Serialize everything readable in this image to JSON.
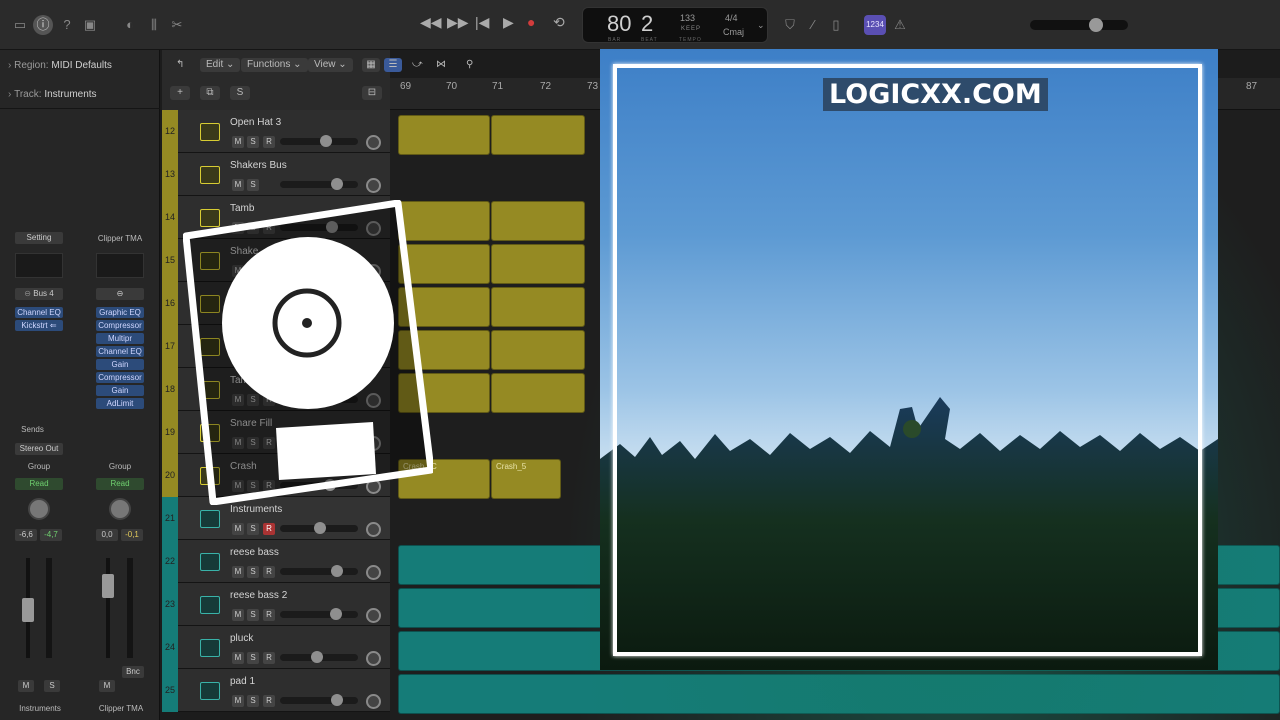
{
  "colors": {
    "accent_yellow": "#958a23",
    "accent_teal": "#157c78",
    "plugin_blue": "#2c4b7a"
  },
  "lcd": {
    "bar": "80",
    "beat": "2",
    "tempo": "133",
    "tempo_label": "KEEP",
    "time_sig": "4/4",
    "key": "Cmaj",
    "bar_label": "BAR",
    "beat_label": "BEAT",
    "tempo_sub": "TEMPO"
  },
  "topbar": {
    "counter_badge": "1234"
  },
  "inspector": {
    "region_label": "Region:",
    "region_value": "MIDI Defaults",
    "track_label": "Track:",
    "track_value": "Instruments",
    "strip1": {
      "setting": "Setting",
      "bus": "Bus 4",
      "plugins": [
        "Channel EQ",
        "Kickstrt ⇐"
      ],
      "sends": "Sends",
      "output": "Stereo Out",
      "group": "Group",
      "read": "Read",
      "vol": "-6,6",
      "pan": "-4,7",
      "m": "M",
      "s": "S",
      "name": "Instruments"
    },
    "strip2": {
      "setting": "Clipper TMA",
      "plugins": [
        "Graphic EQ",
        "Compressor",
        "Multipr",
        "Channel EQ",
        "Gain",
        "Compressor",
        "Gain",
        "AdLimit"
      ],
      "group": "Group",
      "read": "Read",
      "vol": "0,0",
      "pan": "-0,1",
      "bnc": "Bnc",
      "m": "M",
      "name": "Clipper TMA"
    }
  },
  "trackarea": {
    "edit": "Edit",
    "functions": "Functions",
    "view": "View",
    "add": "+",
    "s": "S"
  },
  "ruler": [
    "69",
    "70",
    "71",
    "72",
    "73",
    "87"
  ],
  "tracks": [
    {
      "num": "12",
      "name": "Open Hat 3"
    },
    {
      "num": "13",
      "name": "Shakers Bus"
    },
    {
      "num": "14",
      "name": "Tamb"
    },
    {
      "num": "15",
      "name": "Shake"
    },
    {
      "num": "16",
      "name": ""
    },
    {
      "num": "17",
      "name": ""
    },
    {
      "num": "18",
      "name": "Tam"
    },
    {
      "num": "19",
      "name": "Snare Fill"
    },
    {
      "num": "20",
      "name": "Crash"
    },
    {
      "num": "21",
      "name": "Instruments"
    },
    {
      "num": "22",
      "name": "reese bass"
    },
    {
      "num": "23",
      "name": "reese bass 2"
    },
    {
      "num": "24",
      "name": "pluck"
    },
    {
      "num": "25",
      "name": "pad 1"
    }
  ],
  "regions": {
    "crash_a": "Crash_/C",
    "crash_b": "Crash_5"
  },
  "buttons": {
    "m": "M",
    "s": "S",
    "r": "R"
  },
  "cover": {
    "brand": "LOGICXX.COM"
  }
}
